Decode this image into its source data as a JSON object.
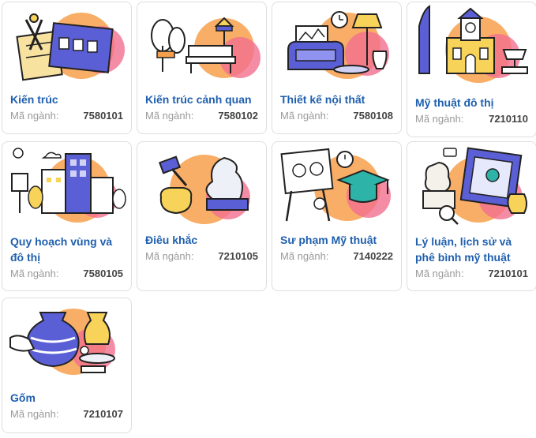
{
  "programs": [
    {
      "name": "Kiến trúc",
      "code_label": "Mã ngành:",
      "code": "7580101",
      "icon": "architecture-blueprint-icon"
    },
    {
      "name": "Kiến trúc cảnh quan",
      "code_label": "Mã ngành:",
      "code": "7580102",
      "icon": "park-bench-landscape-icon"
    },
    {
      "name": "Thiết kế nội thất",
      "code_label": "Mã ngành:",
      "code": "7580108",
      "icon": "armchair-lamp-interior-icon"
    },
    {
      "name": "Mỹ thuật đô thị",
      "code_label": "Mã ngành:",
      "code": "7210110",
      "icon": "city-landmark-icon"
    },
    {
      "name": "Quy hoạch vùng và đô thị",
      "code_label": "Mã ngành:",
      "code": "7580105",
      "icon": "urban-buildings-icon"
    },
    {
      "name": "Điêu khắc",
      "code_label": "Mã ngành:",
      "code": "7210105",
      "icon": "hammer-sculpture-icon"
    },
    {
      "name": "Sư phạm Mỹ thuật",
      "code_label": "Mã ngành:",
      "code": "7140222",
      "icon": "easel-graduation-cap-icon"
    },
    {
      "name": "Lý luận, lịch sử và phê bình mỹ thuật",
      "code_label": "Mã ngành:",
      "code": "7210101",
      "icon": "statue-painting-icon"
    },
    {
      "name": "Gốm",
      "code_label": "Mã ngành:",
      "code": "7210107",
      "icon": "pottery-vase-icon"
    }
  ],
  "colors": {
    "title": "#1f5fae",
    "label": "#9a9a9a",
    "code": "#444444",
    "accent_orange": "#f7a04b",
    "accent_pink": "#f36f8e",
    "accent_purple": "#5b5fd6",
    "accent_yellow": "#f7d35a"
  }
}
